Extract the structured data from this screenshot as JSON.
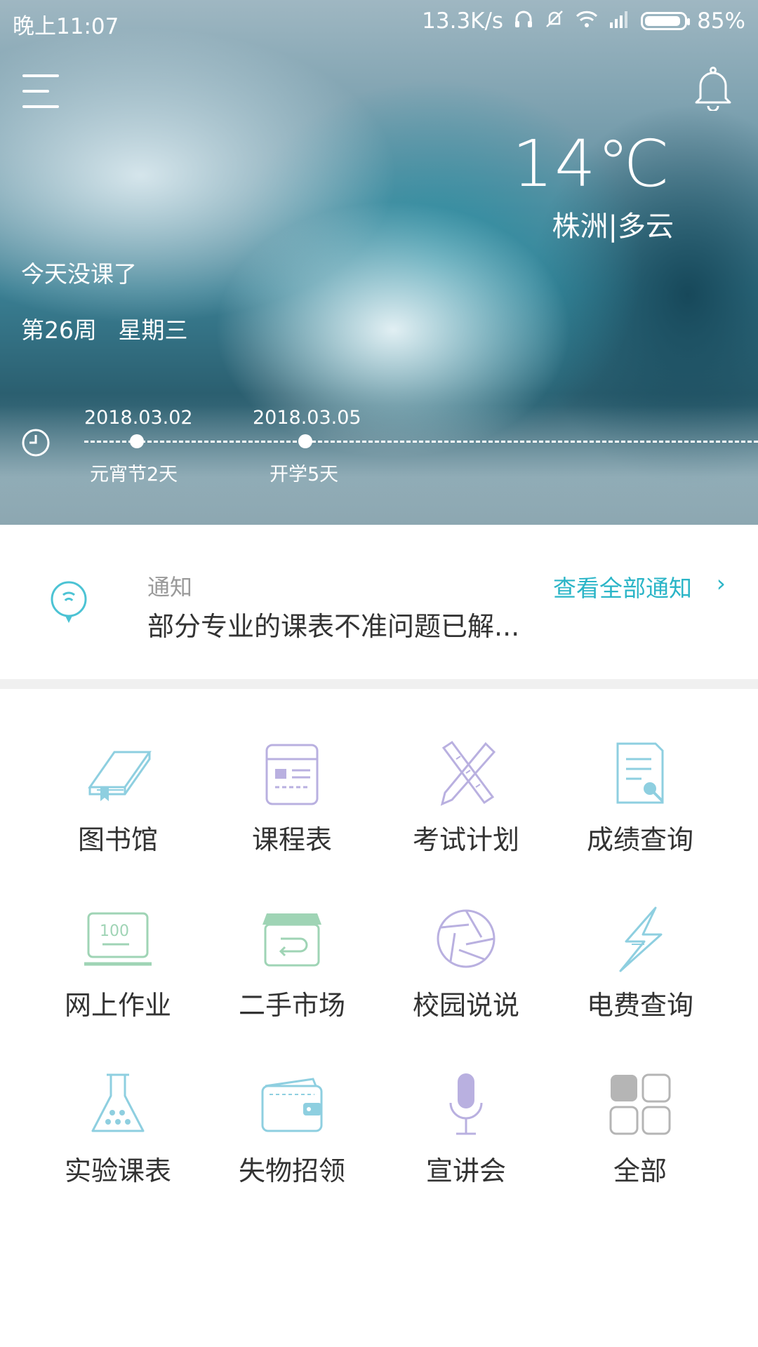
{
  "status_bar": {
    "time": "晚上11:07",
    "net_speed": "13.3K/s",
    "battery": "85%",
    "icons": [
      "headset-icon",
      "mute-icon",
      "wifi-icon",
      "signal-icon",
      "battery-icon"
    ]
  },
  "header": {
    "menu_icon": "menu-icon",
    "bell_icon": "bell-icon"
  },
  "weather": {
    "temperature": "14℃",
    "location": "株洲|多云"
  },
  "schedule": {
    "no_class": "今天没课了",
    "week": "第26周",
    "weekday": "星期三"
  },
  "timeline": {
    "events": [
      {
        "date": "2018.03.02",
        "label": "元宵节2天"
      },
      {
        "date": "2018.03.05",
        "label": "开学5天"
      }
    ]
  },
  "notice": {
    "label": "通知",
    "text": "部分专业的课表不准问题已解...",
    "view_all": "查看全部通知",
    "chevron": "›"
  },
  "apps": [
    {
      "label": "图书馆",
      "icon": "book-icon"
    },
    {
      "label": "课程表",
      "icon": "timetable-icon"
    },
    {
      "label": "考试计划",
      "icon": "ruler-pencil-icon"
    },
    {
      "label": "成绩查询",
      "icon": "document-search-icon"
    },
    {
      "label": "网上作业",
      "icon": "laptop-icon"
    },
    {
      "label": "二手市场",
      "icon": "shop-icon"
    },
    {
      "label": "校园说说",
      "icon": "aperture-icon"
    },
    {
      "label": "电费查询",
      "icon": "lightning-icon"
    },
    {
      "label": "实验课表",
      "icon": "flask-icon"
    },
    {
      "label": "失物招领",
      "icon": "wallet-icon"
    },
    {
      "label": "宣讲会",
      "icon": "microphone-icon"
    },
    {
      "label": "全部",
      "icon": "grid-icon"
    }
  ],
  "colors": {
    "accent": "#2bb5c7",
    "icon_blue": "#8ecfe0",
    "icon_purple": "#b9b0e0",
    "icon_green": "#9fd4b5"
  }
}
